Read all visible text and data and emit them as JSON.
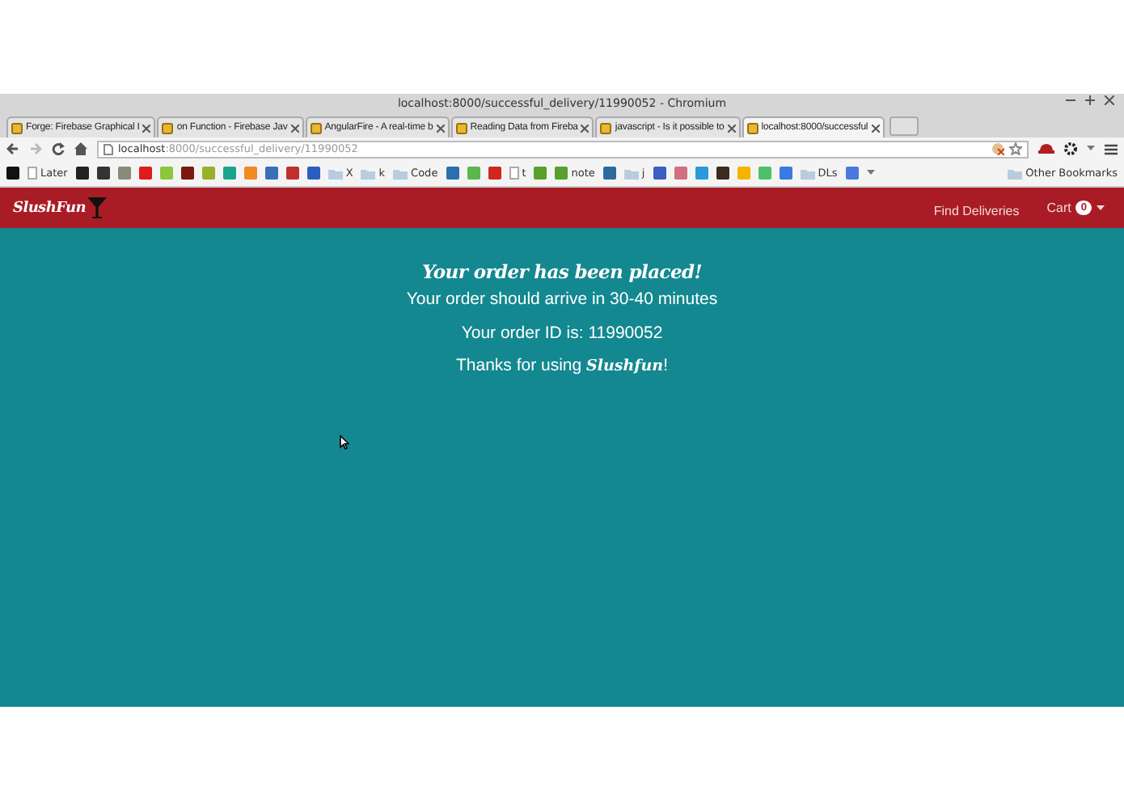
{
  "window": {
    "title": "localhost:8000/successful_delivery/11990052 - Chromium"
  },
  "tabs": [
    {
      "label": "Forge: Firebase Graphical I",
      "selected": false
    },
    {
      "label": "on Function - Firebase Jav",
      "selected": false
    },
    {
      "label": "AngularFire - A real-time b",
      "selected": false
    },
    {
      "label": "Reading Data from Fireba",
      "selected": false
    },
    {
      "label": "javascript - Is it possible to",
      "selected": false
    },
    {
      "label": "localhost:8000/successful",
      "selected": true
    }
  ],
  "address": {
    "host": "localhost",
    "path": ":8000/successful_delivery/11990052"
  },
  "bookmarks": [
    {
      "kind": "site",
      "color": "#111111"
    },
    {
      "kind": "page",
      "label": "Later"
    },
    {
      "kind": "site",
      "color": "#222222"
    },
    {
      "kind": "site",
      "color": "#333333"
    },
    {
      "kind": "site",
      "color": "#8a8a7a"
    },
    {
      "kind": "site",
      "color": "#e01b1b"
    },
    {
      "kind": "site",
      "color": "#8cc63f"
    },
    {
      "kind": "site",
      "color": "#7a1a10"
    },
    {
      "kind": "site",
      "color": "#9ab02a"
    },
    {
      "kind": "site",
      "color": "#1aa58a"
    },
    {
      "kind": "site",
      "color": "#f08a24"
    },
    {
      "kind": "site",
      "color": "#3b6fb6"
    },
    {
      "kind": "site",
      "color": "#c0302a"
    },
    {
      "kind": "site",
      "color": "#2a5fc0"
    },
    {
      "kind": "folder",
      "label": "X"
    },
    {
      "kind": "folder",
      "label": "k"
    },
    {
      "kind": "folder",
      "label": "Code"
    },
    {
      "kind": "site",
      "color": "#2a6fb0"
    },
    {
      "kind": "site",
      "color": "#5ab84a"
    },
    {
      "kind": "site",
      "color": "#d0261e"
    },
    {
      "kind": "page",
      "label": "t"
    },
    {
      "kind": "site",
      "color": "#5aa02c"
    },
    {
      "kind": "site",
      "color": "#5aa02c",
      "label": "note"
    },
    {
      "kind": "site",
      "color": "#2a6aa0"
    },
    {
      "kind": "folder",
      "label": "j"
    },
    {
      "kind": "site",
      "color": "#3a5fc0"
    },
    {
      "kind": "site",
      "color": "#d07080"
    },
    {
      "kind": "site",
      "color": "#2a9ad8"
    },
    {
      "kind": "site",
      "color": "#3a2a20"
    },
    {
      "kind": "site",
      "color": "#f4b400"
    },
    {
      "kind": "site",
      "color": "#4cc06a"
    },
    {
      "kind": "site",
      "color": "#3a7ae0"
    },
    {
      "kind": "folder",
      "label": "DLs"
    },
    {
      "kind": "site",
      "color": "#4a7ae0"
    }
  ],
  "other_bookmarks": "Other Bookmarks",
  "navbar": {
    "brand": "SlushFun",
    "links": [
      "Find Deliveries"
    ],
    "cart": {
      "label": "Cart",
      "count": "0"
    }
  },
  "message": {
    "heading": "Your order has been placed!",
    "lines": [
      "Your order should arrive in 30-40 minutes",
      "Your order ID is: 11990052",
      "Thanks for using **Slushfun**!"
    ]
  }
}
